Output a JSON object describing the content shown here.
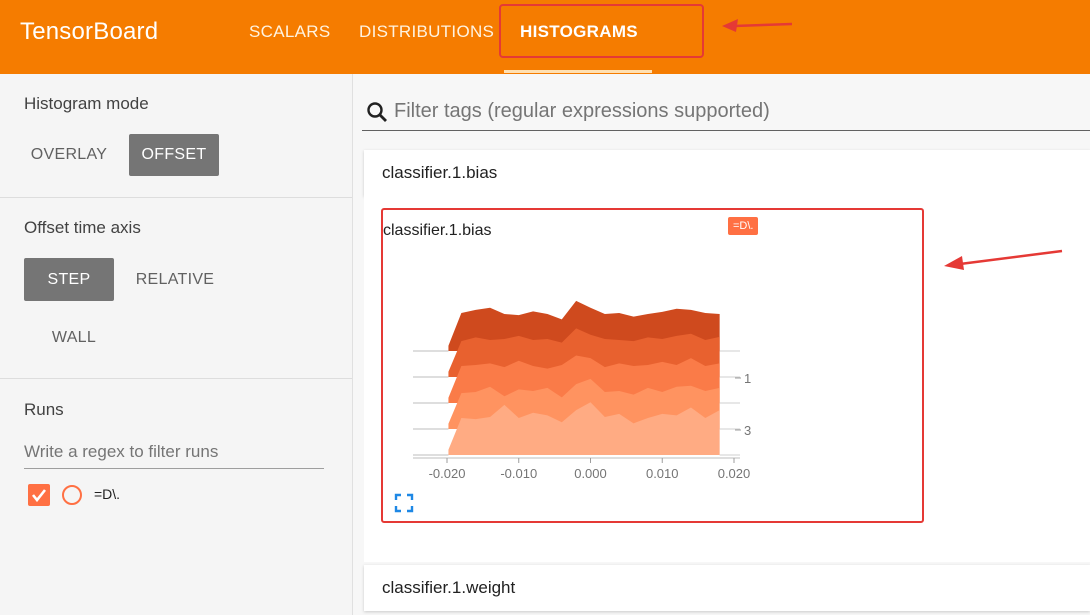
{
  "app": {
    "title": "TensorBoard"
  },
  "tabs": [
    {
      "label": "SCALARS"
    },
    {
      "label": "DISTRIBUTIONS"
    },
    {
      "label": "HISTOGRAMS"
    }
  ],
  "sidebar": {
    "histogram_mode": {
      "title": "Histogram mode",
      "options": [
        "OVERLAY",
        "OFFSET"
      ],
      "selected": "OFFSET"
    },
    "offset_time_axis": {
      "title": "Offset time axis",
      "options": [
        "STEP",
        "RELATIVE",
        "WALL"
      ],
      "selected": "STEP"
    },
    "runs": {
      "title": "Runs",
      "filter_placeholder": "Write a regex to filter runs",
      "items": [
        {
          "name": "=D\\.",
          "checked": true
        }
      ]
    }
  },
  "main": {
    "search_placeholder": "Filter tags (regular expressions supported)",
    "cards": [
      {
        "title": "classifier.1.bias"
      },
      {
        "title": "classifier.1.weight"
      }
    ],
    "chart": {
      "title": "classifier.1.bias",
      "run_tag": "=D\\.",
      "icons": [
        "search-icon",
        "expand-icon"
      ]
    }
  },
  "colors": {
    "header": "#f57c00",
    "run": "#ff7043",
    "annotation": "#e53935"
  },
  "chart_data": {
    "type": "area",
    "mode": "offset",
    "xlim": [
      -0.02,
      0.02
    ],
    "x_ticks": [
      "-0.020",
      "-0.010",
      "0.000",
      "0.010",
      "0.020"
    ],
    "y_ticks": [
      "1",
      "3"
    ],
    "x": [
      -0.0198,
      -0.018,
      -0.016,
      -0.014,
      -0.012,
      -0.01,
      -0.008,
      -0.006,
      -0.004,
      -0.002,
      0.0,
      0.002,
      0.004,
      0.006,
      0.008,
      0.01,
      0.012,
      0.014,
      0.016,
      0.018
    ],
    "series": [
      {
        "values": [
          0.1,
          0.7,
          0.68,
          0.72,
          0.95,
          0.7,
          0.8,
          0.75,
          0.62,
          0.85,
          1.0,
          0.72,
          0.78,
          0.6,
          0.7,
          0.78,
          0.75,
          0.9,
          0.7,
          0.85
        ]
      },
      {
        "values": [
          0.1,
          0.68,
          0.7,
          0.8,
          0.62,
          0.75,
          0.72,
          0.78,
          0.6,
          0.85,
          0.95,
          0.7,
          0.72,
          0.65,
          0.78,
          0.7,
          0.8,
          0.82,
          0.72,
          0.78
        ]
      },
      {
        "values": [
          0.1,
          0.7,
          0.72,
          0.75,
          0.68,
          0.8,
          0.7,
          0.65,
          0.72,
          0.9,
          0.85,
          0.68,
          0.75,
          0.7,
          0.72,
          0.78,
          0.72,
          0.85,
          0.7,
          0.75
        ]
      },
      {
        "values": [
          0.1,
          0.68,
          0.75,
          0.7,
          0.72,
          0.78,
          0.7,
          0.72,
          0.65,
          0.92,
          0.8,
          0.72,
          0.7,
          0.68,
          0.75,
          0.72,
          0.78,
          0.82,
          0.7,
          0.76
        ]
      },
      {
        "values": [
          0.1,
          0.72,
          0.78,
          0.82,
          0.7,
          0.68,
          0.75,
          0.7,
          0.6,
          0.95,
          0.82,
          0.7,
          0.72,
          0.65,
          0.7,
          0.74,
          0.8,
          0.78,
          0.72,
          0.7
        ]
      }
    ]
  }
}
